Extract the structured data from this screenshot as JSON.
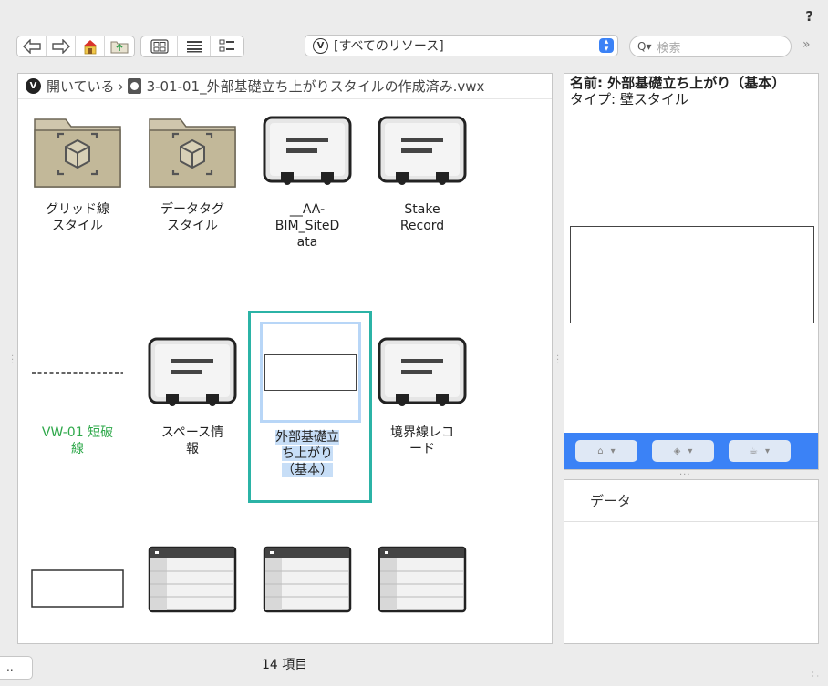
{
  "header": {
    "help": "?"
  },
  "toolbar": {
    "resource_filter": "[すべてのリソース]",
    "search_placeholder": "検索",
    "more": "»"
  },
  "breadcrumb": {
    "open": "開いている",
    "file": "3-01-01_外部基礎立ち上がりスタイルの作成済み.vwx"
  },
  "items": [
    {
      "label": "グリッド線スタイル",
      "type": "folder"
    },
    {
      "label": "データタグスタイル",
      "type": "folder"
    },
    {
      "label": "__AA-BIM_SiteData",
      "type": "record"
    },
    {
      "label": "Stake Record",
      "type": "record"
    },
    {
      "label": "VW-01 短破線",
      "type": "line"
    },
    {
      "label": "スペース情報",
      "type": "record"
    },
    {
      "label": "外部基礎立ち上がり（基本）",
      "type": "wall-style",
      "selected": true
    },
    {
      "label": "境界線レコード",
      "type": "record"
    },
    {
      "label": "",
      "type": "rect"
    },
    {
      "label": "",
      "type": "worksheet"
    },
    {
      "label": "",
      "type": "worksheet"
    },
    {
      "label": "",
      "type": "worksheet"
    }
  ],
  "labels_display": {
    "i0": "グリッド線\nスタイル",
    "i1": "データタグ\nスタイル",
    "i2": "__AA-\nBIM_SiteD\nata",
    "i3": "Stake\nRecord",
    "i4": "VW-01 短破\n線",
    "i5": "スペース情\n報",
    "i6": "外部基礎立\nち上がり\n（基本）",
    "i7": "境界線レコ\nード"
  },
  "info": {
    "name": "名前: 外部基礎立ち上がり（基本）",
    "type": "タイプ: 壁スタイル"
  },
  "data_panel": {
    "header": "データ"
  },
  "status": {
    "button": "..",
    "count": "14 項目"
  },
  "colors": {
    "accent": "#3b82f6",
    "selection_frame": "#2bb3a6",
    "selection_highlight": "#c7def7",
    "green_label": "#2ea84a"
  }
}
